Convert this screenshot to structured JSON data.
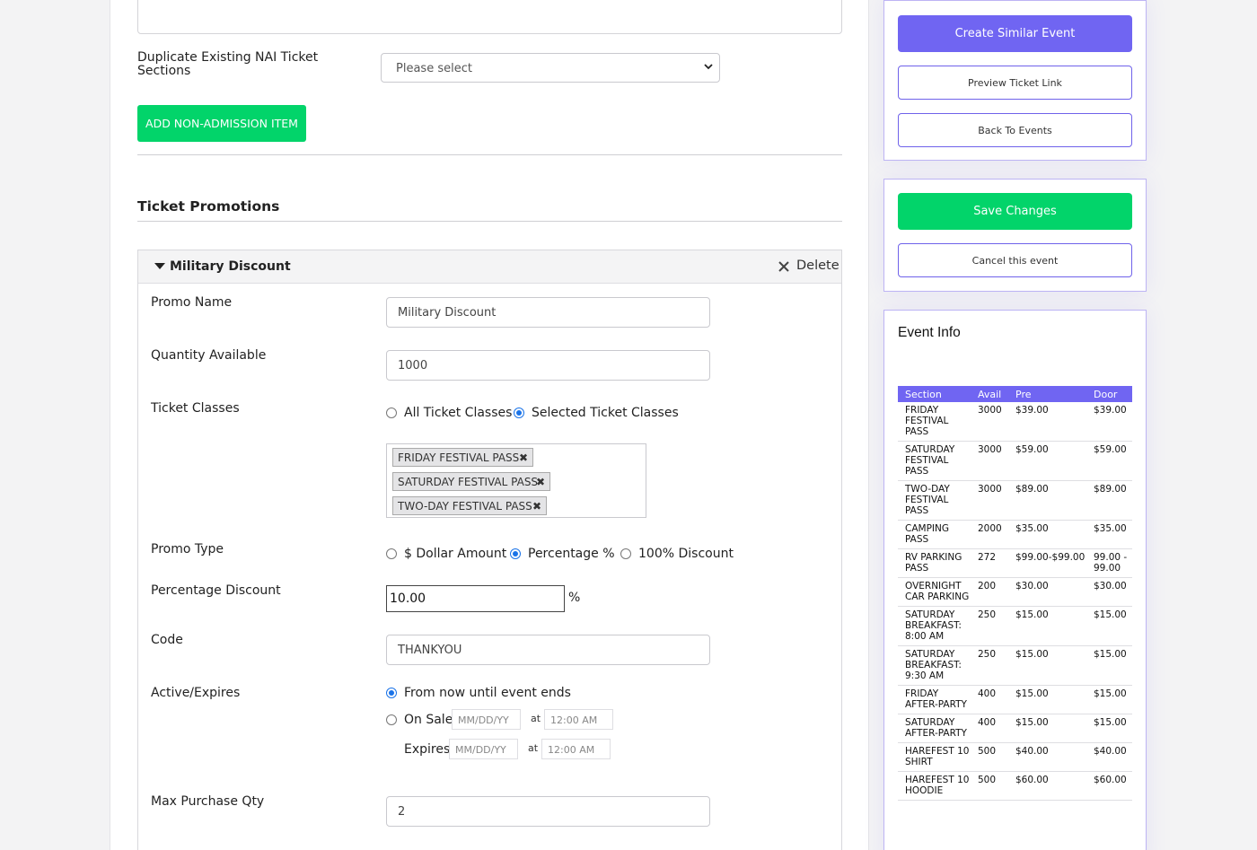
{
  "form": {
    "duplicate_label": "Duplicate Existing NAI Ticket Sections",
    "duplicate_select_value": "Please select",
    "add_item_button": "ADD NON-ADMISSION ITEM",
    "promotions_title": "Ticket Promotions"
  },
  "promo": {
    "title": "Military Discount",
    "delete_label": "Delete",
    "promo_name_label": "Promo Name",
    "promo_name_value": "Military Discount",
    "quantity_label": "Quantity Available",
    "quantity_value": "1000",
    "ticket_classes_label": "Ticket Classes",
    "ticket_class_options": [
      "All Ticket Classes",
      "Selected Ticket Classes"
    ],
    "ticket_class_selected": "Selected Ticket Classes",
    "selected_classes": [
      "FRIDAY FESTIVAL PASS",
      "SATURDAY FESTIVAL PASS",
      "TWO-DAY FESTIVAL PASS"
    ],
    "promo_type_label": "Promo Type",
    "promo_type_options": [
      "$ Dollar Amount",
      "Percentage %",
      "100% Discount"
    ],
    "promo_type_selected": "Percentage %",
    "percentage_label": "Percentage Discount",
    "percentage_value": "10.00",
    "percent_sign": "%",
    "code_label": "Code",
    "code_value": "THANKYOU",
    "active_label": "Active/Expires",
    "active_option_now": "From now until event ends",
    "active_option_onsale": "On Sale",
    "expires_label": "Expires",
    "date_placeholder": "MM/DD/YY",
    "time_placeholder": "12:00 AM",
    "at_label": "at",
    "max_qty_label": "Max Purchase Qty",
    "max_qty_value": "2"
  },
  "sidebar": {
    "create_similar": "Create Similar Event",
    "preview_link": "Preview Ticket Link",
    "back_to_events": "Back To Events",
    "save_changes": "Save Changes",
    "cancel_event": "Cancel this event",
    "event_info_title": "Event Info",
    "table_headers": [
      "Section",
      "Avail",
      "Pre",
      "Door"
    ],
    "table_rows": [
      [
        "FRIDAY FESTIVAL PASS",
        "3000",
        "$39.00",
        "$39.00"
      ],
      [
        "SATURDAY FESTIVAL PASS",
        "3000",
        "$59.00",
        "$59.00"
      ],
      [
        "TWO-DAY FESTIVAL PASS",
        "3000",
        "$89.00",
        "$89.00"
      ],
      [
        "CAMPING PASS",
        "2000",
        "$35.00",
        "$35.00"
      ],
      [
        "RV PARKING PASS",
        "272",
        "$99.00-$99.00",
        "99.00 - 99.00"
      ],
      [
        "OVERNIGHT CAR PARKING",
        "200",
        "$30.00",
        "$30.00"
      ],
      [
        "SATURDAY BREAKFAST: 8:00 AM",
        "250",
        "$15.00",
        "$15.00"
      ],
      [
        "SATURDAY BREAKFAST: 9:30 AM",
        "250",
        "$15.00",
        "$15.00"
      ],
      [
        "FRIDAY AFTER-PARTY",
        "400",
        "$15.00",
        "$15.00"
      ],
      [
        "SATURDAY AFTER-PARTY",
        "400",
        "$15.00",
        "$15.00"
      ],
      [
        "HAREFEST 10 SHIRT",
        "500",
        "$40.00",
        "$40.00"
      ],
      [
        "HAREFEST 10 HOODIE",
        "500",
        "$60.00",
        "$60.00"
      ]
    ]
  },
  "colors": {
    "accent_violet": "#7065f2",
    "accent_green": "#02d46a",
    "radio_blue": "#1a73e8"
  }
}
